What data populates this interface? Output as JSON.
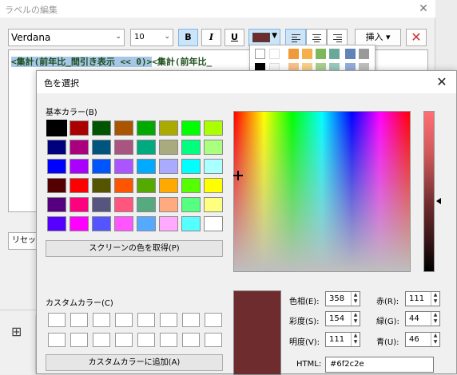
{
  "bg_window": {
    "title": "ラベルの編集",
    "font_family_value": "Verdana",
    "font_size_value": "10",
    "bold_label": "B",
    "italic_label": "I",
    "underline_label": "U",
    "font_color": "#6f2c2e",
    "insert_label": "挿入",
    "editor_text_selected": "<集計(前年比_間引き表示 << 0)>",
    "editor_text_rest": "<集計(前年比_",
    "reset_label": "リセッ"
  },
  "palette_popup": {
    "colors": [
      "#ffffff",
      "#ffffff",
      "#f5a65b",
      "#f5b556",
      "#8fbf6a",
      "#7db7a8",
      "#6f93c2",
      "#a3a3a3"
    ]
  },
  "dialog": {
    "title": "色を選択",
    "basic_colors_label": "基本カラー(B)",
    "basic_colors": [
      "#000000",
      "#aa0000",
      "#005500",
      "#aa5500",
      "#00aa00",
      "#aaaa00",
      "#00ff00",
      "#aaff00",
      "#00007f",
      "#aa007f",
      "#00557f",
      "#aa557f",
      "#00aa7f",
      "#aaaa7f",
      "#00ff7f",
      "#aaff7f",
      "#0000ff",
      "#aa00ff",
      "#0055ff",
      "#aa55ff",
      "#00aaff",
      "#aaaaff",
      "#00ffff",
      "#aaffff",
      "#550000",
      "#ff0000",
      "#555500",
      "#ff5500",
      "#55aa00",
      "#ffaa00",
      "#55ff00",
      "#ffff00",
      "#55007f",
      "#ff007f",
      "#55557f",
      "#ff557f",
      "#55aa7f",
      "#ffaa7f",
      "#55ff7f",
      "#ffff7f",
      "#5500ff",
      "#ff00ff",
      "#5555ff",
      "#ff55ff",
      "#55aaff",
      "#ffaaff",
      "#55ffff",
      "#ffffff"
    ],
    "grab_screen_label": "スクリーンの色を取得(P)",
    "custom_colors_label": "カスタムカラー(C)",
    "add_custom_label": "カスタムカラーに追加(A)",
    "current_color": "#6f2c2e",
    "fields": {
      "hue_label": "色相(E):",
      "hue": "358",
      "sat_label": "彩度(S):",
      "sat": "154",
      "val_label": "明度(V):",
      "val": "111",
      "red_label": "赤(R):",
      "red": "111",
      "green_label": "緑(G):",
      "green": "44",
      "blue_label": "青(U):",
      "blue": "46",
      "html_label": "HTML:",
      "html": "#6f2c2e"
    }
  }
}
